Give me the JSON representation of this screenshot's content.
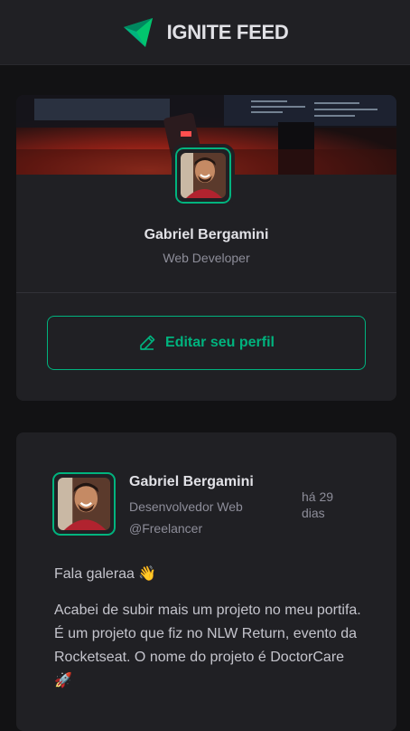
{
  "header": {
    "title": "IGNITE FEED",
    "logo_icon": "ignite-logo-icon"
  },
  "sidebar": {
    "profile": {
      "name": "Gabriel Bergamini",
      "role": "Web Developer",
      "edit_label": "Editar seu perfil",
      "edit_icon": "pencil-icon"
    }
  },
  "post": {
    "author": {
      "name": "Gabriel Bergamini",
      "role": "Desenvolvedor Web @Freelancer"
    },
    "time": "há 29 dias",
    "paragraphs": [
      "Fala galeraa 👋",
      "Acabei de subir mais um projeto no meu portifa. É um projeto que fiz no NLW Return, evento da Rocketseat. O nome do projeto é DoctorCare 🚀"
    ]
  },
  "colors": {
    "background": "#121214",
    "surface": "#202024",
    "accent": "#00b37e",
    "text": "#e1e1e6",
    "muted": "#8d8d99"
  }
}
